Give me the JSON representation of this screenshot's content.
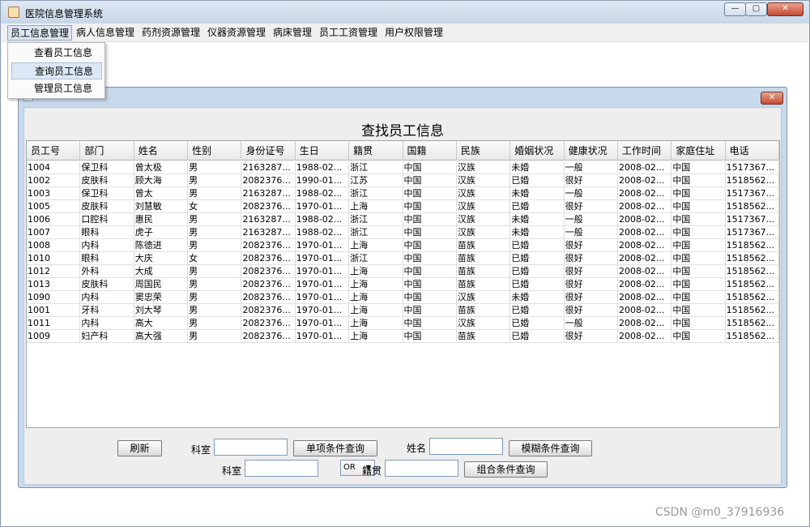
{
  "window": {
    "title": "医院信息管理系统",
    "min": "—",
    "max": "▢",
    "close": "✕"
  },
  "menubar": [
    "员工信息管理",
    "病人信息管理",
    "药剂资源管理",
    "仪器资源管理",
    "病床管理",
    "员工工资管理",
    "用户权限管理"
  ],
  "dropdown": [
    "查看员工信息",
    "查询员工信息",
    "管理员工信息"
  ],
  "inner": {
    "close": "✕",
    "heading": "查找员工信息"
  },
  "table": {
    "columns": [
      "员工号",
      "部门",
      "姓名",
      "性别",
      "身份证号",
      "生日",
      "籍贯",
      "国籍",
      "民族",
      "婚姻状况",
      "健康状况",
      "工作时间",
      "家庭住址",
      "电话"
    ],
    "rows": [
      [
        "1004",
        "保卫科",
        "曾太极",
        "男",
        "2163287...",
        "1988-02...",
        "浙江",
        "中国",
        "汉族",
        "未婚",
        "一般",
        "2008-02...",
        "中国",
        "1517367..."
      ],
      [
        "1002",
        "皮肤科",
        "顾大海",
        "男",
        "2082376...",
        "1990-01...",
        "江苏",
        "中国",
        "汉族",
        "已婚",
        "很好",
        "2008-02...",
        "中国",
        "1518562..."
      ],
      [
        "1003",
        "保卫科",
        "曾太",
        "男",
        "2163287...",
        "1988-02...",
        "浙江",
        "中国",
        "汉族",
        "未婚",
        "一般",
        "2008-02...",
        "中国",
        "1517367..."
      ],
      [
        "1005",
        "皮肤科",
        "刘慧敏",
        "女",
        "2082376...",
        "1970-01...",
        "上海",
        "中国",
        "汉族",
        "已婚",
        "很好",
        "2008-02...",
        "中国",
        "1518562..."
      ],
      [
        "1006",
        "口腔科",
        "惠民",
        "男",
        "2163287...",
        "1988-02...",
        "浙江",
        "中国",
        "汉族",
        "未婚",
        "一般",
        "2008-02...",
        "中国",
        "1517367..."
      ],
      [
        "1007",
        "眼科",
        "虎子",
        "男",
        "2163287...",
        "1988-02...",
        "浙江",
        "中国",
        "汉族",
        "未婚",
        "一般",
        "2008-02...",
        "中国",
        "1517367..."
      ],
      [
        "1008",
        "内科",
        "陈德进",
        "男",
        "2082376...",
        "1970-01...",
        "上海",
        "中国",
        "苗族",
        "已婚",
        "很好",
        "2008-02...",
        "中国",
        "1518562..."
      ],
      [
        "1010",
        "眼科",
        "大庆",
        "女",
        "2082376...",
        "1970-01...",
        "浙江",
        "中国",
        "苗族",
        "已婚",
        "很好",
        "2008-02...",
        "中国",
        "1518562..."
      ],
      [
        "1012",
        "外科",
        "大成",
        "男",
        "2082376...",
        "1970-01...",
        "上海",
        "中国",
        "苗族",
        "已婚",
        "很好",
        "2008-02...",
        "中国",
        "1518562..."
      ],
      [
        "1013",
        "皮肤科",
        "周国民",
        "男",
        "2082376...",
        "1970-01...",
        "上海",
        "中国",
        "苗族",
        "已婚",
        "很好",
        "2008-02...",
        "中国",
        "1518562..."
      ],
      [
        "1090",
        "内科",
        "窦忠荣",
        "男",
        "2082376...",
        "1970-01...",
        "上海",
        "中国",
        "汉族",
        "未婚",
        "很好",
        "2008-02...",
        "中国",
        "1518562..."
      ],
      [
        "1001",
        "牙科",
        "刘大琴",
        "男",
        "2082376...",
        "1970-01...",
        "上海",
        "中国",
        "苗族",
        "已婚",
        "很好",
        "2008-02...",
        "中国",
        "1518562..."
      ],
      [
        "1011",
        "内科",
        "高大",
        "男",
        "2082376...",
        "1970-01...",
        "上海",
        "中国",
        "汉族",
        "已婚",
        "一般",
        "2008-02...",
        "中国",
        "1518562..."
      ],
      [
        "1009",
        "妇产科",
        "高大强",
        "男",
        "2082376...",
        "1970-01...",
        "上海",
        "中国",
        "苗族",
        "已婚",
        "很好",
        "2008-02...",
        "中国",
        "1518562..."
      ]
    ]
  },
  "controls": {
    "refresh": "刷新",
    "dept_label": "科室",
    "single_query": "单项条件查询",
    "name_label": "姓名",
    "fuzzy_query": "模糊条件查询",
    "dept_label2": "科室",
    "combo_value": "OR",
    "native_label": "籍贯",
    "combined_query": "组合条件查询"
  },
  "watermark": "CSDN @m0_37916936"
}
